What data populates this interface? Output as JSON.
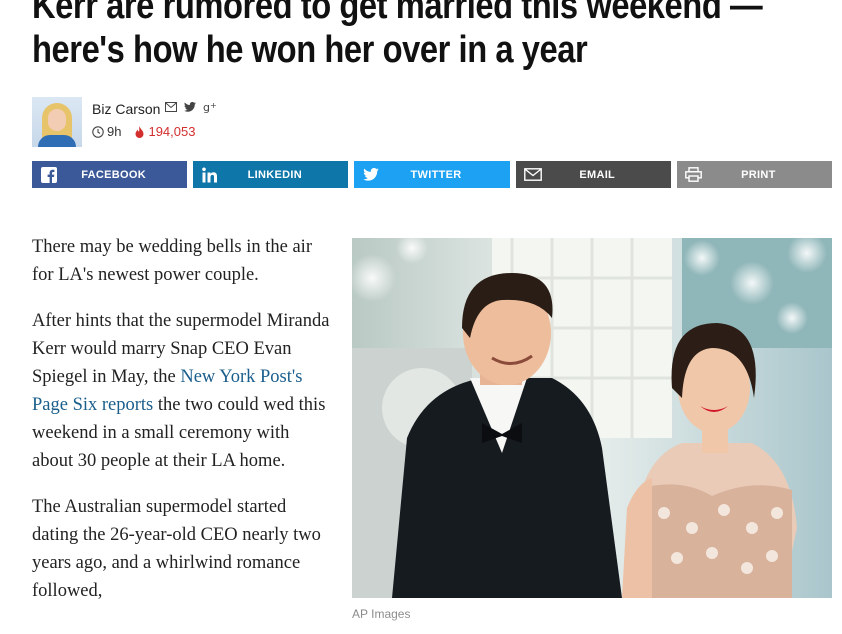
{
  "article": {
    "headline": "Kerr are rumored to get married this weekend — here's how he won her over in a year"
  },
  "byline": {
    "author": "Biz Carson",
    "time": "9h",
    "views": "194,053",
    "icons": [
      "email-icon",
      "twitter-icon",
      "google-plus-icon"
    ]
  },
  "share": {
    "facebook": "FACEBOOK",
    "linkedin": "LINKEDIN",
    "twitter": "TWITTER",
    "email": "EMAIL",
    "print": "PRINT"
  },
  "body": {
    "p1": "There may be wedding bells in the air for LA's newest power couple.",
    "p2_before": "After hints that the supermodel Miranda Kerr would marry Snap CEO Evan Spiegel in May, the ",
    "p2_link": "New York Post's Page Six reports",
    "p2_after": " the two could wed this weekend in a small ceremony with about 30 people at their LA home.",
    "p3": "The Australian supermodel started dating the 26-year-old CEO nearly two years ago, and a whirlwind romance followed,"
  },
  "photo": {
    "caption": "AP Images"
  },
  "colors": {
    "facebook": "#3b5998",
    "linkedin": "#0e76a8",
    "twitter": "#1da1f2",
    "email": "#4b4b4b",
    "print": "#8b8b8b",
    "views": "#d32f2f",
    "link": "#1a5e8c"
  }
}
